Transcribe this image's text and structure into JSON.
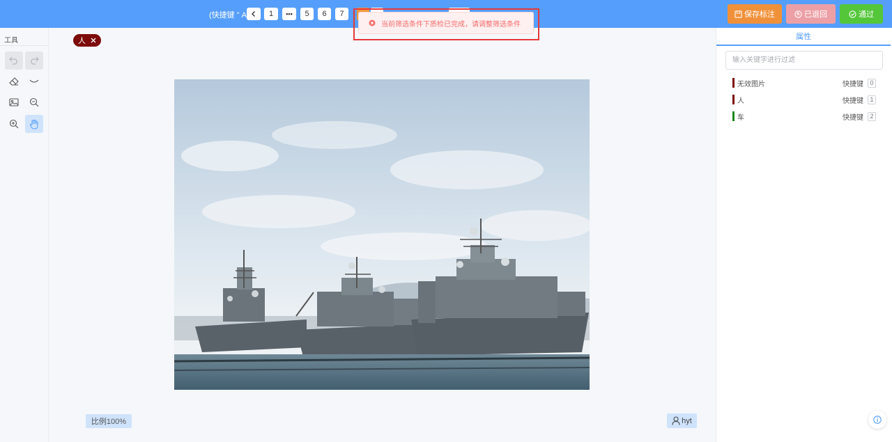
{
  "topbar": {
    "shortcut_hint": "(快捷键 \" A \")",
    "pagination": {
      "prev_label": "<",
      "pages": [
        "1",
        "•••",
        "5",
        "6",
        "7"
      ]
    },
    "actions": {
      "save_label": "保存标注",
      "returned_label": "已退回",
      "pass_label": "通过"
    }
  },
  "alert": {
    "message": "当前筛选条件下质检已完成，请调整筛选条件"
  },
  "left_panel": {
    "title": "工具",
    "tools": [
      {
        "name": "undo-icon",
        "state": "disabled"
      },
      {
        "name": "redo-icon",
        "state": "disabled"
      },
      {
        "name": "eraser-icon",
        "state": "normal"
      },
      {
        "name": "eye-closed-icon",
        "state": "normal"
      },
      {
        "name": "image-icon",
        "state": "normal"
      },
      {
        "name": "zoom-out-icon",
        "state": "normal"
      },
      {
        "name": "zoom-in-icon",
        "state": "normal"
      },
      {
        "name": "hand-pan-icon",
        "state": "active"
      }
    ]
  },
  "canvas": {
    "tag_label": "人",
    "zoom_label": "比例100%",
    "user_label": "hyt"
  },
  "right_panel": {
    "tab_label": "属性",
    "search_placeholder": "输入关键字进行过滤",
    "shortcut_word": "快捷键",
    "labels": [
      {
        "name": "无效图片",
        "key": "0",
        "color": "#7d0b0b"
      },
      {
        "name": "人",
        "key": "1",
        "color": "#7d0b0b"
      },
      {
        "name": "车",
        "key": "2",
        "color": "#1a8a1a"
      }
    ]
  },
  "colors": {
    "topbar": "#559efb",
    "save": "#f0913a",
    "returned": "#eca0a6",
    "pass": "#54c63a",
    "alert_text": "#f56c6c",
    "alert_border": "#e8383b"
  }
}
